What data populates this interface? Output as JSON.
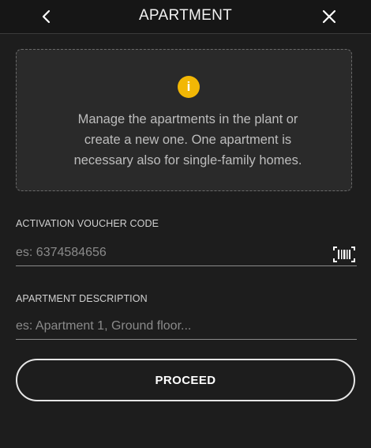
{
  "header": {
    "title": "APARTMENT",
    "back_icon": "chevron-left-icon",
    "close_icon": "close-icon"
  },
  "info": {
    "icon": "info-icon",
    "icon_color": "#f2b705",
    "text_line1": "Manage the apartments in the plant or",
    "text_line2": "create a new one. One apartment is",
    "text_line3": "necessary also for single-family homes."
  },
  "voucher": {
    "label": "ACTIVATION VOUCHER CODE",
    "placeholder": "es: 6374584656",
    "value": "",
    "scan_icon": "barcode-scan-icon"
  },
  "description": {
    "label": "APARTMENT DESCRIPTION",
    "placeholder": "es: Apartment 1, Ground floor...",
    "value": ""
  },
  "proceed_label": "PROCEED"
}
